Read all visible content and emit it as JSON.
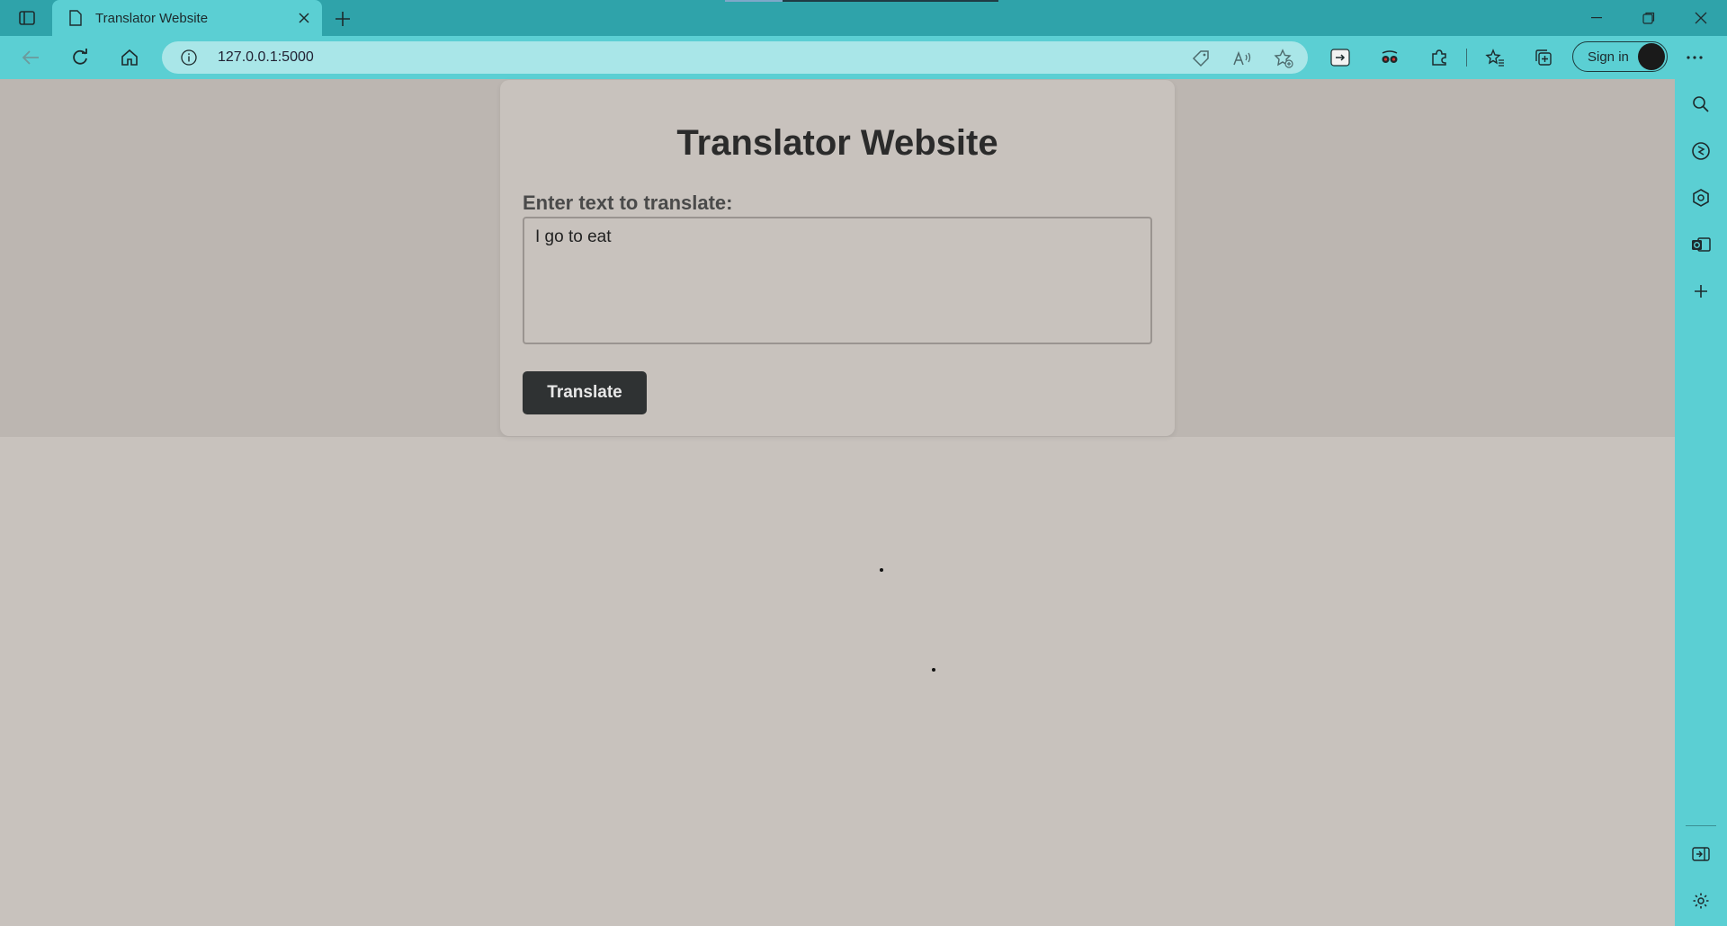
{
  "browser": {
    "tab": {
      "title": "Translator Website"
    },
    "address_bar": {
      "url": "127.0.0.1:5000"
    },
    "sign_in_label": "Sign in",
    "colors": {
      "frame": "#2fa3aa",
      "toolbar": "#5bcfd3",
      "address": "#a9e6e8"
    }
  },
  "page": {
    "heading": "Translator Website",
    "input_label": "Enter text to translate:",
    "input_value": "I go to eat",
    "translate_button": "Translate",
    "colors": {
      "background": "#c8c2bd",
      "button": "#2f3233"
    }
  }
}
